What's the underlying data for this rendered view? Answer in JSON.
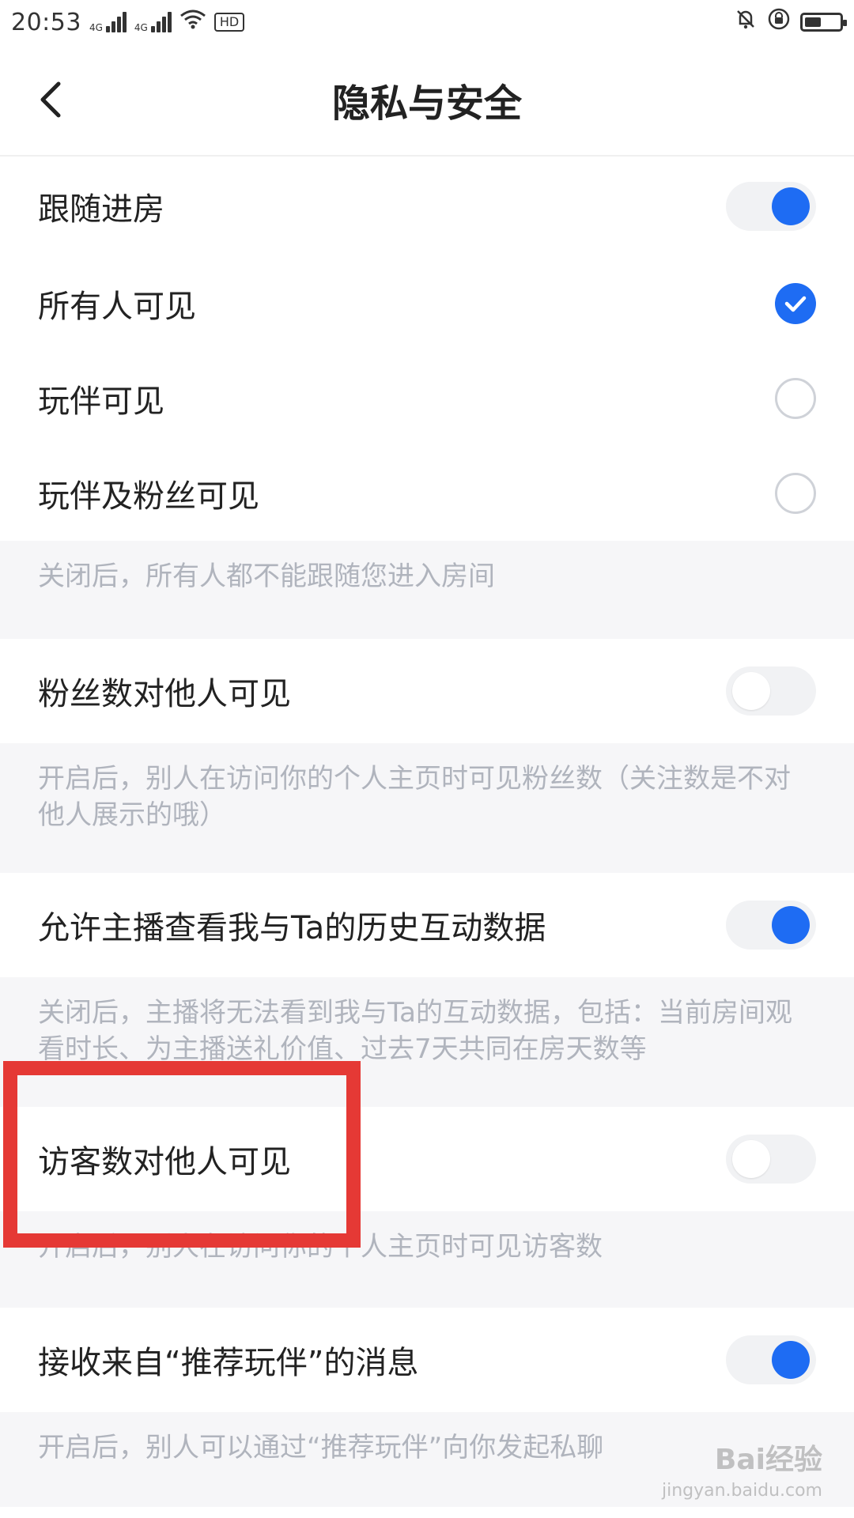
{
  "status_bar": {
    "time": "20:53",
    "signal_label": "4G",
    "hd_label": "HD"
  },
  "header": {
    "title": "隐私与安全"
  },
  "sections": {
    "follow_room": {
      "label": "跟随进房",
      "enabled": true,
      "options": [
        {
          "label": "所有人可见",
          "selected": true
        },
        {
          "label": "玩伴可见",
          "selected": false
        },
        {
          "label": "玩伴及粉丝可见",
          "selected": false
        }
      ],
      "note": "关闭后，所有人都不能跟随您进入房间"
    },
    "fans_visible": {
      "label": "粉丝数对他人可见",
      "enabled": false,
      "note": "开启后，别人在访问你的个人主页时可见粉丝数（关注数是不对他人展示的哦）"
    },
    "history_data": {
      "label": "允许主播查看我与Ta的历史互动数据",
      "enabled": true,
      "note": "关闭后，主播将无法看到我与Ta的互动数据，包括：当前房间观看时长、为主播送礼价值、过去7天共同在房天数等"
    },
    "visitors_visible": {
      "label": "访客数对他人可见",
      "enabled": false,
      "note": "开启后，别人在访问你的个人主页时可见访客数"
    },
    "recommend_msg": {
      "label": "接收来自“推荐玩伴”的消息",
      "enabled": true,
      "note": "开启后，别人可以通过“推荐玩伴”向你发起私聊"
    }
  },
  "colors": {
    "accent": "#1e6cf3",
    "highlight": "#e53935",
    "note_bg": "#f6f6f8"
  },
  "watermark": {
    "brand": "Bai经验",
    "url": "jingyan.baidu.com"
  }
}
